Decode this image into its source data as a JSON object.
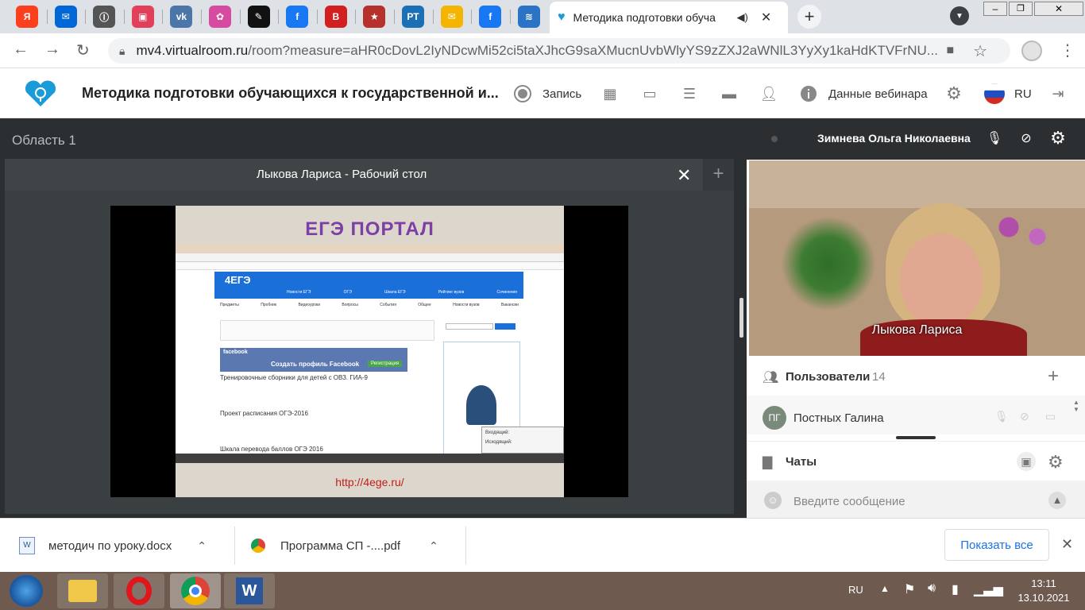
{
  "browser": {
    "pinned_tabs": [
      {
        "icon": "yandex-icon",
        "glyph": "Я",
        "color": "#fc3f1d"
      },
      {
        "icon": "mail-icon",
        "glyph": "✉",
        "color": "#0068d6"
      },
      {
        "icon": "document-icon",
        "glyph": "Ⓘ",
        "color": "#555555"
      },
      {
        "icon": "image-icon",
        "glyph": "▣",
        "color": "#e23f5a"
      },
      {
        "icon": "vk-icon",
        "glyph": "vk",
        "color": "#4a76a8"
      },
      {
        "icon": "flower-icon",
        "glyph": "✿",
        "color": "#d64aa0"
      },
      {
        "icon": "dark-app-icon",
        "glyph": "✎",
        "color": "#111111"
      },
      {
        "icon": "facebook-icon",
        "glyph": "f",
        "color": "#1877f2"
      },
      {
        "icon": "red-book-icon",
        "glyph": "В",
        "color": "#d21f1f"
      },
      {
        "icon": "star-badge-icon",
        "glyph": "★",
        "color": "#b7312c"
      },
      {
        "icon": "rt-icon",
        "glyph": "РТ",
        "color": "#1a6fb5"
      },
      {
        "icon": "envelope-icon",
        "glyph": "✉",
        "color": "#f4b400"
      },
      {
        "icon": "facebook-icon",
        "glyph": "f",
        "color": "#1877f2"
      },
      {
        "icon": "wave-icon",
        "glyph": "≋",
        "color": "#2b73c4"
      }
    ],
    "active_tab_title": "Методика подготовки обуча",
    "new_tab": "+",
    "url_host": "mv4.virtualroom.ru",
    "url_rest": "/room?measure=aHR0cDovL2IyNDcwMi52ci5taXJhcG9saXMucnUvbWlyYS9zZXJ2aWNlL3YyXy1kaHdKTVFrNU..."
  },
  "app": {
    "title": "Методика подготовки обучающихся к государственной и...",
    "record_label": "Запись",
    "webinar_data_label": "Данные вебинара",
    "language": "RU"
  },
  "stage": {
    "area_label": "Область 1",
    "panel_title": "Лыкова Лариса - Рабочий стол",
    "slide": {
      "title": "ЕГЭ ПОРТАЛ",
      "url": "http://4ege.ru/",
      "inner": {
        "logo": "4ЕГЭ",
        "nav": [
          "Новости ЕГЭ",
          "ОГЭ",
          "Шкала ЕГЭ",
          "Рейтинг вузов",
          "Сочинения"
        ],
        "menu": [
          "Предметы",
          "Пробник",
          "Видеоуроки",
          "Вопросы",
          "События",
          "Общее",
          "Новости вузов",
          "Вакансии"
        ],
        "facebook_banner": "Создать профиль Facebook",
        "facebook_label": "facebook",
        "register_btn": "Регистрация",
        "article1": "Тренировочные сборники для детей с ОВЗ. ГИА-9",
        "article2": "Проект расписания ОГЭ-2016",
        "article3": "Шкала перевода баллов ОГЭ 2016",
        "popup_in": "Входящий:",
        "popup_out": "Исходящий:"
      }
    }
  },
  "sidebar": {
    "speaker_name": "Зимнева Ольга Николаевна",
    "video_name": "Лыкова Лариса",
    "users_label": "Пользователи",
    "users_count": "14",
    "user_initials": "ПГ",
    "user_name": "Постных Галина",
    "chats_label": "Чаты",
    "message_placeholder": "Введите сообщение"
  },
  "downloads": {
    "item1": "методич по уроку.docx",
    "item2": "Программа СП -....pdf",
    "show_all": "Показать все"
  },
  "taskbar": {
    "lang": "RU",
    "time": "13:11",
    "date": "13.10.2021"
  },
  "colors": {
    "accent": "#1a9ad6",
    "dark": "#2b2f31"
  }
}
